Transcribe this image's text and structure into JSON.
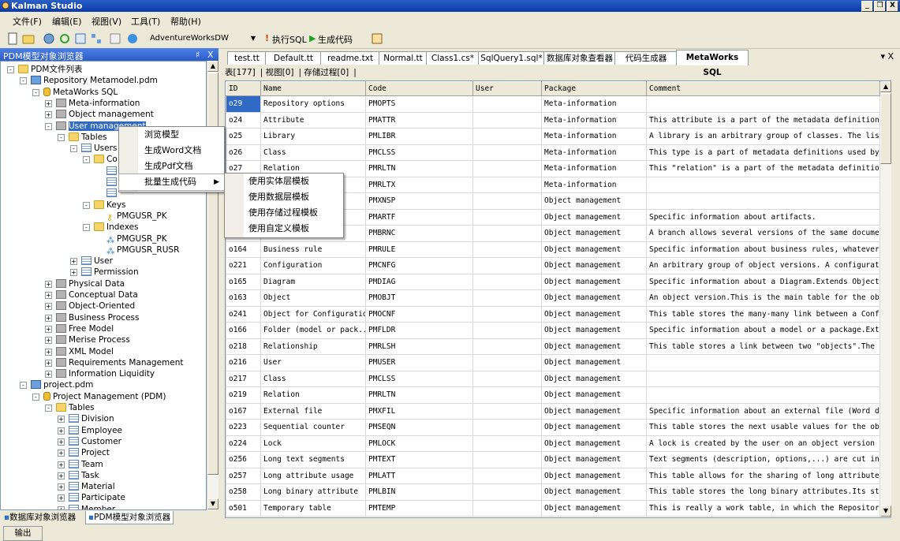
{
  "window": {
    "title": "Kalman Studio",
    "buttons": [
      "_",
      "❐",
      "X"
    ]
  },
  "menu": [
    "文件(F)",
    "编辑(E)",
    "视图(V)",
    "工具(T)",
    "帮助(H)"
  ],
  "toolbar": {
    "database": "AdventureWorksDW",
    "exec_sql": "执行SQL",
    "gen_code": "生成代码"
  },
  "left_panel": {
    "title": "PDM模型对象浏览器",
    "pin": "ᵖ",
    "close": "X",
    "bottom_tabs": [
      "数据库对象浏览器",
      "PDM模型对象浏览器"
    ],
    "output_tab": "输出"
  },
  "tree": [
    {
      "label": "PDM文件列表",
      "icon": "folder-icon",
      "indent": 0,
      "pm": "-"
    },
    {
      "label": "Repository Metamodel.pdm",
      "icon": "model-icon",
      "indent": 1,
      "pm": "-"
    },
    {
      "label": "MetaWorks SQL",
      "icon": "database-icon",
      "indent": 2,
      "pm": "-"
    },
    {
      "label": "Meta-information",
      "icon": "package-icon",
      "indent": 3,
      "pm": "+"
    },
    {
      "label": "Object management",
      "icon": "package-icon",
      "indent": 3,
      "pm": "+"
    },
    {
      "label": "User management",
      "icon": "package-icon",
      "indent": 3,
      "pm": "-",
      "selected": true
    },
    {
      "label": "Tables",
      "icon": "folder-icon",
      "indent": 4,
      "pm": "-"
    },
    {
      "label": "Users",
      "icon": "table-icon",
      "indent": 5,
      "pm": "-"
    },
    {
      "label": "Co",
      "icon": "folder-icon",
      "indent": 6,
      "pm": "-"
    },
    {
      "label": "",
      "icon": "column-icon",
      "indent": 7,
      "pm": ""
    },
    {
      "label": "",
      "icon": "column-icon",
      "indent": 7,
      "pm": ""
    },
    {
      "label": "",
      "icon": "column-icon",
      "indent": 7,
      "pm": ""
    },
    {
      "label": "Keys",
      "icon": "folder-icon",
      "indent": 6,
      "pm": "-"
    },
    {
      "label": "PMGUSR_PK",
      "icon": "key-icon",
      "indent": 7,
      "pm": ""
    },
    {
      "label": "Indexes",
      "icon": "folder-icon",
      "indent": 6,
      "pm": "-"
    },
    {
      "label": "PMGUSR_PK",
      "icon": "index-icon",
      "indent": 7,
      "pm": ""
    },
    {
      "label": "PMGUSR_RUSR",
      "icon": "index-icon",
      "indent": 7,
      "pm": ""
    },
    {
      "label": "User",
      "icon": "table-icon",
      "indent": 5,
      "pm": "+"
    },
    {
      "label": "Permission",
      "icon": "table-icon",
      "indent": 5,
      "pm": "+"
    },
    {
      "label": "Physical Data",
      "icon": "package-icon",
      "indent": 3,
      "pm": "+"
    },
    {
      "label": "Conceptual Data",
      "icon": "package-icon",
      "indent": 3,
      "pm": "+"
    },
    {
      "label": "Object-Oriented",
      "icon": "package-icon",
      "indent": 3,
      "pm": "+"
    },
    {
      "label": "Business Process",
      "icon": "package-icon",
      "indent": 3,
      "pm": "+"
    },
    {
      "label": "Free Model",
      "icon": "package-icon",
      "indent": 3,
      "pm": "+"
    },
    {
      "label": "Merise Process",
      "icon": "package-icon",
      "indent": 3,
      "pm": "+"
    },
    {
      "label": "XML Model",
      "icon": "package-icon",
      "indent": 3,
      "pm": "+"
    },
    {
      "label": "Requirements Management",
      "icon": "package-icon",
      "indent": 3,
      "pm": "+"
    },
    {
      "label": "Information Liquidity",
      "icon": "package-icon",
      "indent": 3,
      "pm": "+"
    },
    {
      "label": "project.pdm",
      "icon": "model-icon",
      "indent": 1,
      "pm": "-"
    },
    {
      "label": "Project Management (PDM)",
      "icon": "database-icon",
      "indent": 2,
      "pm": "-"
    },
    {
      "label": "Tables",
      "icon": "folder-icon",
      "indent": 3,
      "pm": "-"
    },
    {
      "label": "Division",
      "icon": "table-icon",
      "indent": 4,
      "pm": "+"
    },
    {
      "label": "Employee",
      "icon": "table-icon",
      "indent": 4,
      "pm": "+"
    },
    {
      "label": "Customer",
      "icon": "table-icon",
      "indent": 4,
      "pm": "+"
    },
    {
      "label": "Project",
      "icon": "table-icon",
      "indent": 4,
      "pm": "+"
    },
    {
      "label": "Team",
      "icon": "table-icon",
      "indent": 4,
      "pm": "+"
    },
    {
      "label": "Task",
      "icon": "table-icon",
      "indent": 4,
      "pm": "+"
    },
    {
      "label": "Material",
      "icon": "table-icon",
      "indent": 4,
      "pm": "+"
    },
    {
      "label": "Participate",
      "icon": "table-icon",
      "indent": 4,
      "pm": "+"
    },
    {
      "label": "Member",
      "icon": "table-icon",
      "indent": 4,
      "pm": "+"
    },
    {
      "label": "Used",
      "icon": "table-icon",
      "indent": 4,
      "pm": "+"
    }
  ],
  "doc_tabs": [
    "test.tt",
    "Default.tt",
    "readme.txt",
    "Normal.tt",
    "Class1.cs*",
    "SqlQuery1.sql*",
    "数据库对象查看器",
    "代码生成器",
    "MetaWorks SQL"
  ],
  "doc_close": "▾ X",
  "sub_tabs": [
    "表[177]",
    "视图[0]",
    "存储过程[0]"
  ],
  "grid": {
    "columns": [
      "ID",
      "Name",
      "Code",
      "User",
      "Package",
      "Comment"
    ],
    "rows": [
      [
        "o29",
        "Repository options",
        "PMOPTS",
        "",
        "Meta-information",
        ""
      ],
      [
        "o24",
        "Attribute",
        "PMATTR",
        "",
        "Meta-information",
        "This attribute is a part of the metadata definition..."
      ],
      [
        "o25",
        "Library",
        "PMLIBR",
        "",
        "Meta-information",
        "A library is an arbitrary group of classes. The lis..."
      ],
      [
        "o26",
        "Class",
        "PMCLSS",
        "",
        "Meta-information",
        "This type is a part of metadata definitions used by..."
      ],
      [
        "o27",
        "Relation",
        "PMRLTN",
        "",
        "Meta-information",
        "This \"relation\" is a part of the metadata definitio..."
      ],
      [
        "o28",
        "Relation in...",
        "PMRLTX",
        "",
        "Meta-information",
        ""
      ],
      [
        "o",
        "",
        "PMXNSP",
        "",
        "Object management",
        ""
      ],
      [
        "o",
        "",
        "PMARTF",
        "",
        "Object management",
        "Specific information about artifacts."
      ],
      [
        "o",
        "",
        "PMBRNC",
        "",
        "Object management",
        "A branch allows several versions of the same docume..."
      ],
      [
        "o164",
        "Business rule",
        "PMRULE",
        "",
        "Object management",
        "Specific information about business rules, whatever..."
      ],
      [
        "o221",
        "Configuration",
        "PMCNFG",
        "",
        "Object management",
        "An arbitrary group of object versions. A configurat..."
      ],
      [
        "o165",
        "Diagram",
        "PMDIAG",
        "",
        "Object management",
        "Specific information about a Diagram.Extends Object..."
      ],
      [
        "o163",
        "Object",
        "PMOBJT",
        "",
        "Object management",
        "An object version.This is the main table for the ob..."
      ],
      [
        "o241",
        "Object for Configuration",
        "PMOCNF",
        "",
        "Object management",
        "This table stores the many-many link between a Conf..."
      ],
      [
        "o166",
        "Folder (model or pack...",
        "PMFLDR",
        "",
        "Object management",
        "Specific information about a model or a package.Ext..."
      ],
      [
        "o218",
        "Relationship",
        "PMRLSH",
        "",
        "Object management",
        "This table stores a link between two \"objects\".The ..."
      ],
      [
        "o216",
        "User",
        "PMUSER",
        "",
        "Object management",
        ""
      ],
      [
        "o217",
        "Class",
        "PMCLSS",
        "",
        "Object management",
        ""
      ],
      [
        "o219",
        "Relation",
        "PMRLTN",
        "",
        "Object management",
        ""
      ],
      [
        "o167",
        "External file",
        "PMXFIL",
        "",
        "Object management",
        "Specific information about an external file (Word d..."
      ],
      [
        "o223",
        "Sequential counter",
        "PMSEQN",
        "",
        "Object management",
        "This table stores the next usable values for the ob..."
      ],
      [
        "o224",
        "Lock",
        "PMLOCK",
        "",
        "Object management",
        "A lock is created by the user on an object version ..."
      ],
      [
        "o256",
        "Long text segments",
        "PMTEXT",
        "",
        "Object management",
        "Text segments (description, options,...) are cut in..."
      ],
      [
        "o257",
        "Long attribute usage",
        "PMLATT",
        "",
        "Object management",
        "This table allows for the sharing of long attribute..."
      ],
      [
        "o258",
        "Long binary attribute",
        "PMLBIN",
        "",
        "Object management",
        "This table stores the long binary attributes.Its st..."
      ],
      [
        "o501",
        "Temporary table",
        "PMTEMP",
        "",
        "Object management",
        "This is really a work table, in which the Repositor..."
      ]
    ]
  },
  "context_menu": [
    "浏览模型",
    "生成Word文档",
    "生成Pdf文档",
    "批量生成代码"
  ],
  "submenu": [
    "使用实体层模板",
    "使用数据层模板",
    "使用存储过程模板",
    "使用自定义模板"
  ],
  "submenu_arrow": "▶"
}
